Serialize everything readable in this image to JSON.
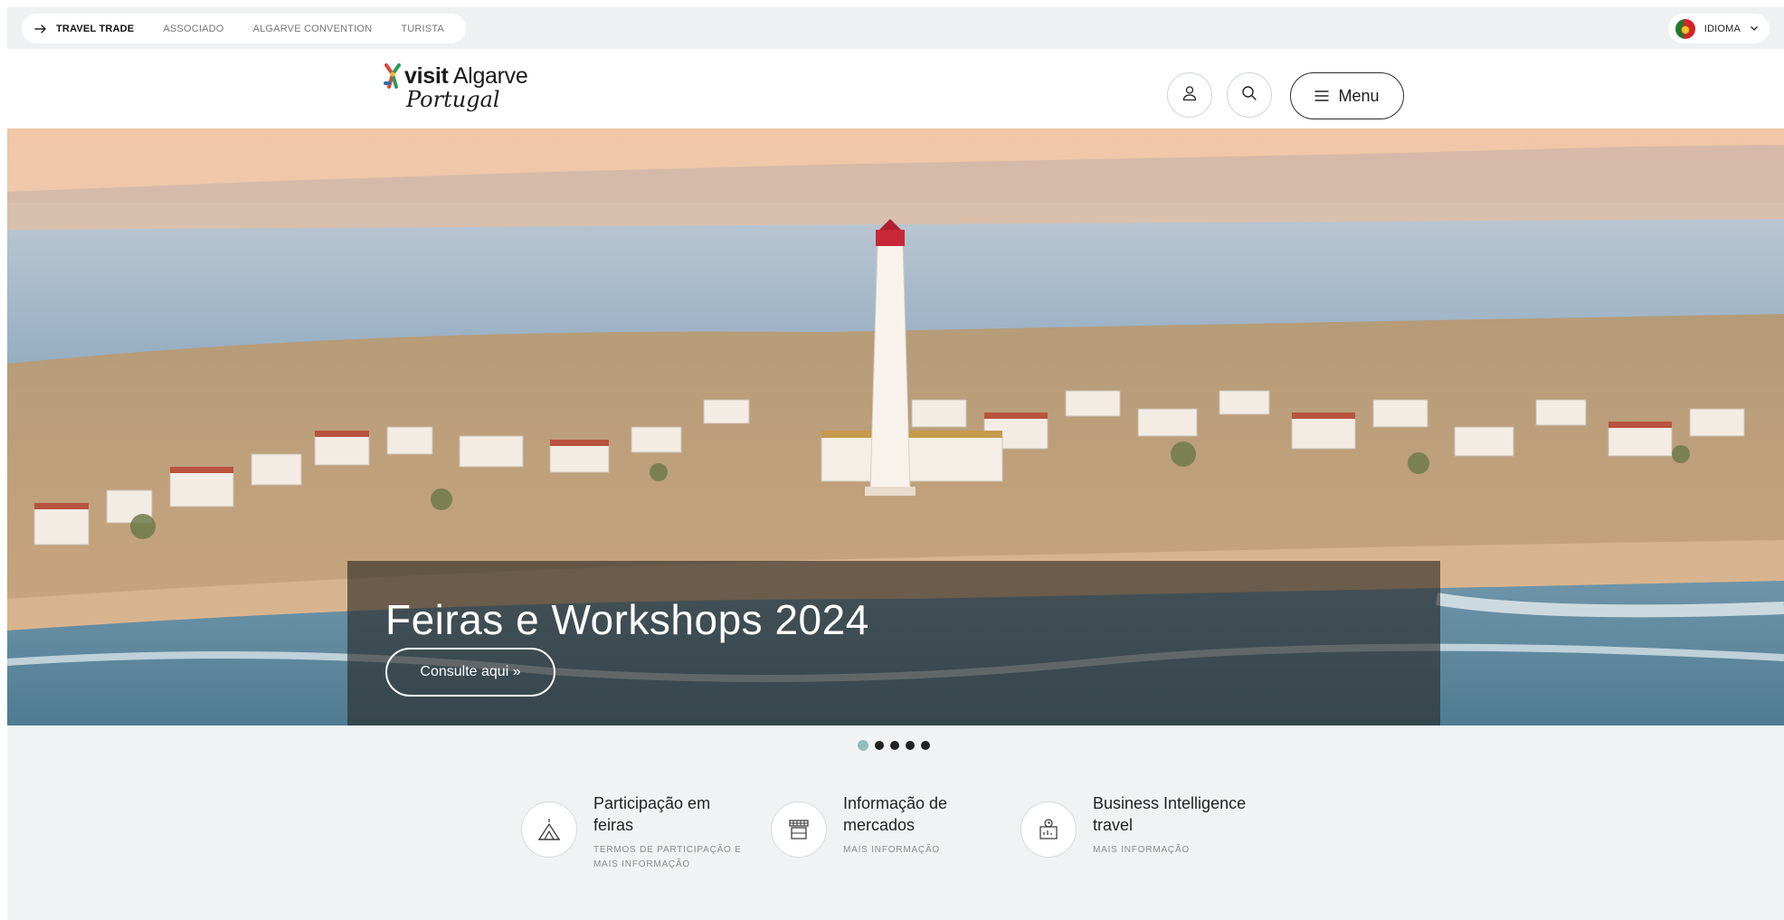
{
  "audience_nav": {
    "items": [
      {
        "label": "TRAVEL TRADE",
        "active": true
      },
      {
        "label": "ASSOCIADO",
        "active": false
      },
      {
        "label": "ALGARVE CONVENTION",
        "active": false
      },
      {
        "label": "TURISTA",
        "active": false
      }
    ]
  },
  "language": {
    "label": "IDIOMA",
    "flag": "portugal-flag"
  },
  "logo": {
    "line1_bold": "visit",
    "line1_rest": "Algarve",
    "line2": "Portugal"
  },
  "header": {
    "menu_label": "Menu",
    "user_icon": "user-icon",
    "search_icon": "search-icon"
  },
  "hero": {
    "title": "Feiras e Workshops 2024",
    "cta": "Consulte aqui »",
    "slides_total": 5,
    "active_slide": 1
  },
  "features": [
    {
      "title": "Participação em feiras",
      "subtitle": "TERMOS DE PARTICIPAÇÃO E MAIS INFORMAÇÃO",
      "icon": "tent-icon"
    },
    {
      "title": "Informação de mercados",
      "subtitle": "MAIS INFORMAÇÃO",
      "icon": "market-stall-icon"
    },
    {
      "title": "Business Intelligence travel",
      "subtitle": "MAIS INFORMAÇÃO",
      "icon": "analytics-icon"
    }
  ],
  "colors": {
    "accent_dot": "#8fbfb8",
    "page_bg": "#f0f2f4",
    "overlay": "rgba(40,38,36,0.62)"
  }
}
